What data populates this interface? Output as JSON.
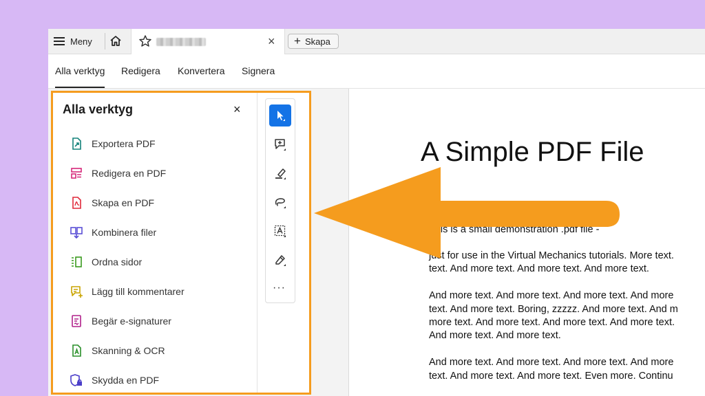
{
  "topbar": {
    "menu_label": "Meny",
    "create_label": "Skapa",
    "tab_close": "×"
  },
  "navtabs": [
    "Alla verktyg",
    "Redigera",
    "Konvertera",
    "Signera"
  ],
  "panel": {
    "title": "Alla verktyg",
    "close": "×",
    "tools": [
      {
        "label": "Exportera PDF",
        "icon": "export-pdf-icon",
        "color": "#13827a"
      },
      {
        "label": "Redigera en PDF",
        "icon": "edit-pdf-icon",
        "color": "#d6287a"
      },
      {
        "label": "Skapa en PDF",
        "icon": "create-pdf-icon",
        "color": "#e0293a"
      },
      {
        "label": "Kombinera filer",
        "icon": "combine-files-icon",
        "color": "#5a4fd6"
      },
      {
        "label": "Ordna sidor",
        "icon": "organize-pages-icon",
        "color": "#3a9a1e"
      },
      {
        "label": "Lägg till kommentarer",
        "icon": "add-comment-icon",
        "color": "#c9a400"
      },
      {
        "label": "Begär e-signaturer",
        "icon": "request-esign-icon",
        "color": "#b0208a"
      },
      {
        "label": "Skanning & OCR",
        "icon": "scan-ocr-icon",
        "color": "#2a8f2a"
      },
      {
        "label": "Skydda en PDF",
        "icon": "protect-pdf-icon",
        "color": "#4b3fc9"
      }
    ],
    "more": "···"
  },
  "document": {
    "title": "A Simple PDF File",
    "lines": [
      "This is a small demonstration .pdf file -",
      "just for use in the Virtual Mechanics tutorials. More text.",
      "text. And more text. And more text. And more text.",
      "And more text. And more text. And more text. And more",
      "text. And more text. Boring, zzzzz. And more text. And m",
      "more text. And more text. And more text. And more text.",
      "And more text. And more text.",
      "And more text. And more text. And more text. And more",
      "text. And more text. And more text. Even more. Continu"
    ]
  },
  "colors": {
    "highlight_border": "#f59c1e",
    "arrow": "#f59c1e",
    "background": "#d7b8f5",
    "accent": "#1473e6"
  }
}
